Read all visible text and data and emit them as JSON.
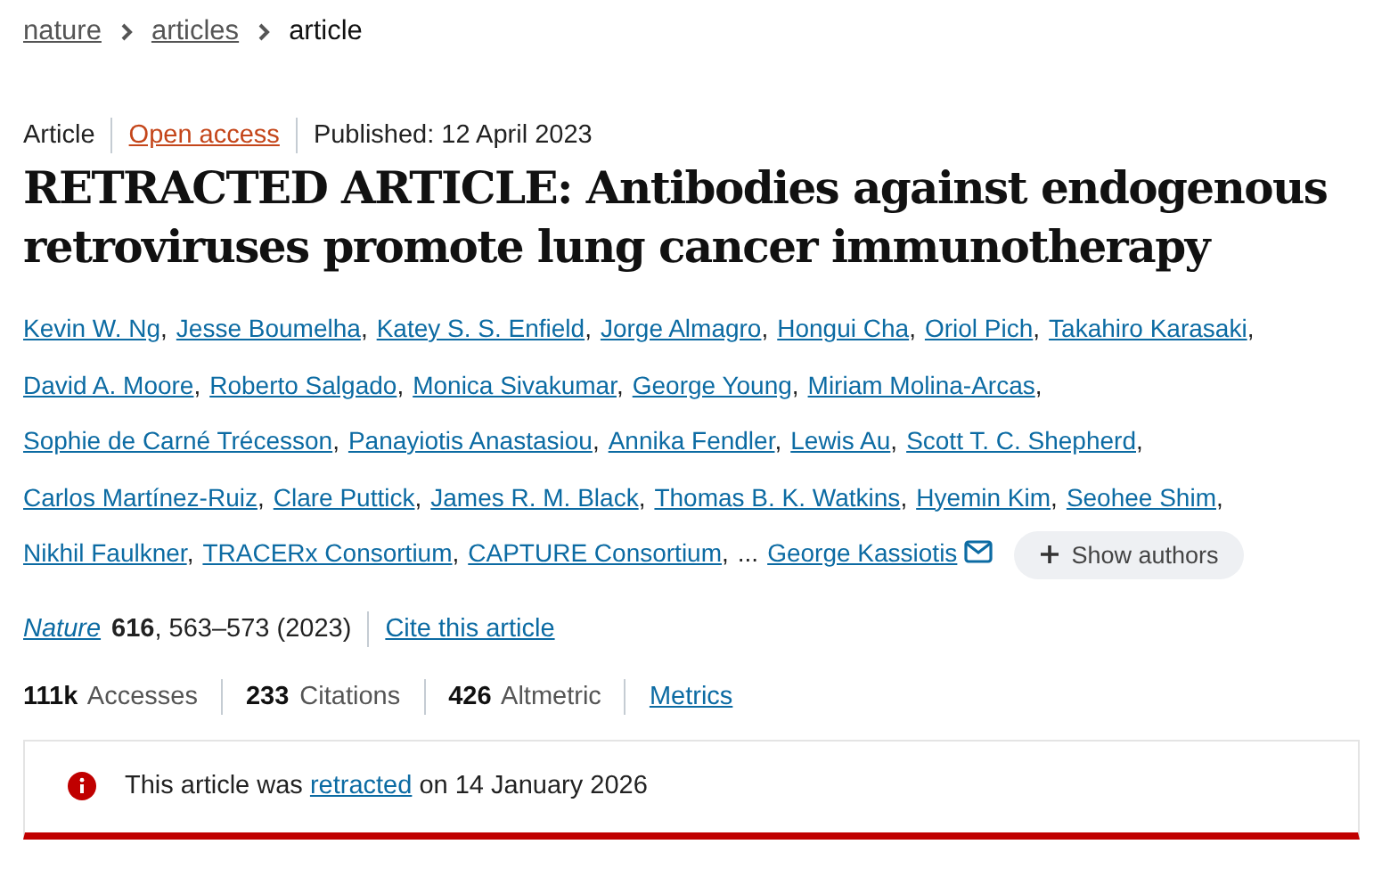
{
  "breadcrumbs": [
    {
      "label": "nature",
      "link": true
    },
    {
      "label": "articles",
      "link": true
    },
    {
      "label": "article",
      "link": false
    }
  ],
  "meta": {
    "type": "Article",
    "access": "Open access",
    "published": "Published: 12 April 2023"
  },
  "title": "RETRACTED ARTICLE: Antibodies against endogenous retroviruses promote lung cancer immunotherapy",
  "authors": [
    "Kevin W. Ng",
    "Jesse Boumelha",
    "Katey S. S. Enfield",
    "Jorge Almagro",
    "Hongui Cha",
    "Oriol Pich",
    "Takahiro Karasaki",
    "David A. Moore",
    "Roberto Salgado",
    "Monica Sivakumar",
    "George Young",
    "Miriam Molina-Arcas",
    "Sophie de Carné Trécesson",
    "Panayiotis Anastasiou",
    "Annika Fendler",
    "Lewis Au",
    "Scott T. C. Shepherd",
    "Carlos Martínez-Ruiz",
    "Clare Puttick",
    "James R. M. Black",
    "Thomas B. K. Watkins",
    "Hyemin Kim",
    "Seohee Shim",
    "Nikhil Faulkner",
    "TRACERx Consortium",
    "CAPTURE Consortium"
  ],
  "separator": ",",
  "ellipsis": "...",
  "corresponding_author": "George Kassiotis",
  "show_authors": "Show authors",
  "citation": {
    "journal": "Nature",
    "details": "**616**, 563–573 (2023)",
    "cite_link": "Cite this article"
  },
  "metrics": [
    {
      "count": "111k",
      "name": "Accesses"
    },
    {
      "count": "233",
      "name": "Citations"
    },
    {
      "count": "426",
      "name": "Altmetric"
    }
  ],
  "metrics_link": "Metrics",
  "notice": {
    "before": "This article was",
    "link": "retracted",
    "after": "on 14 January 2026"
  }
}
